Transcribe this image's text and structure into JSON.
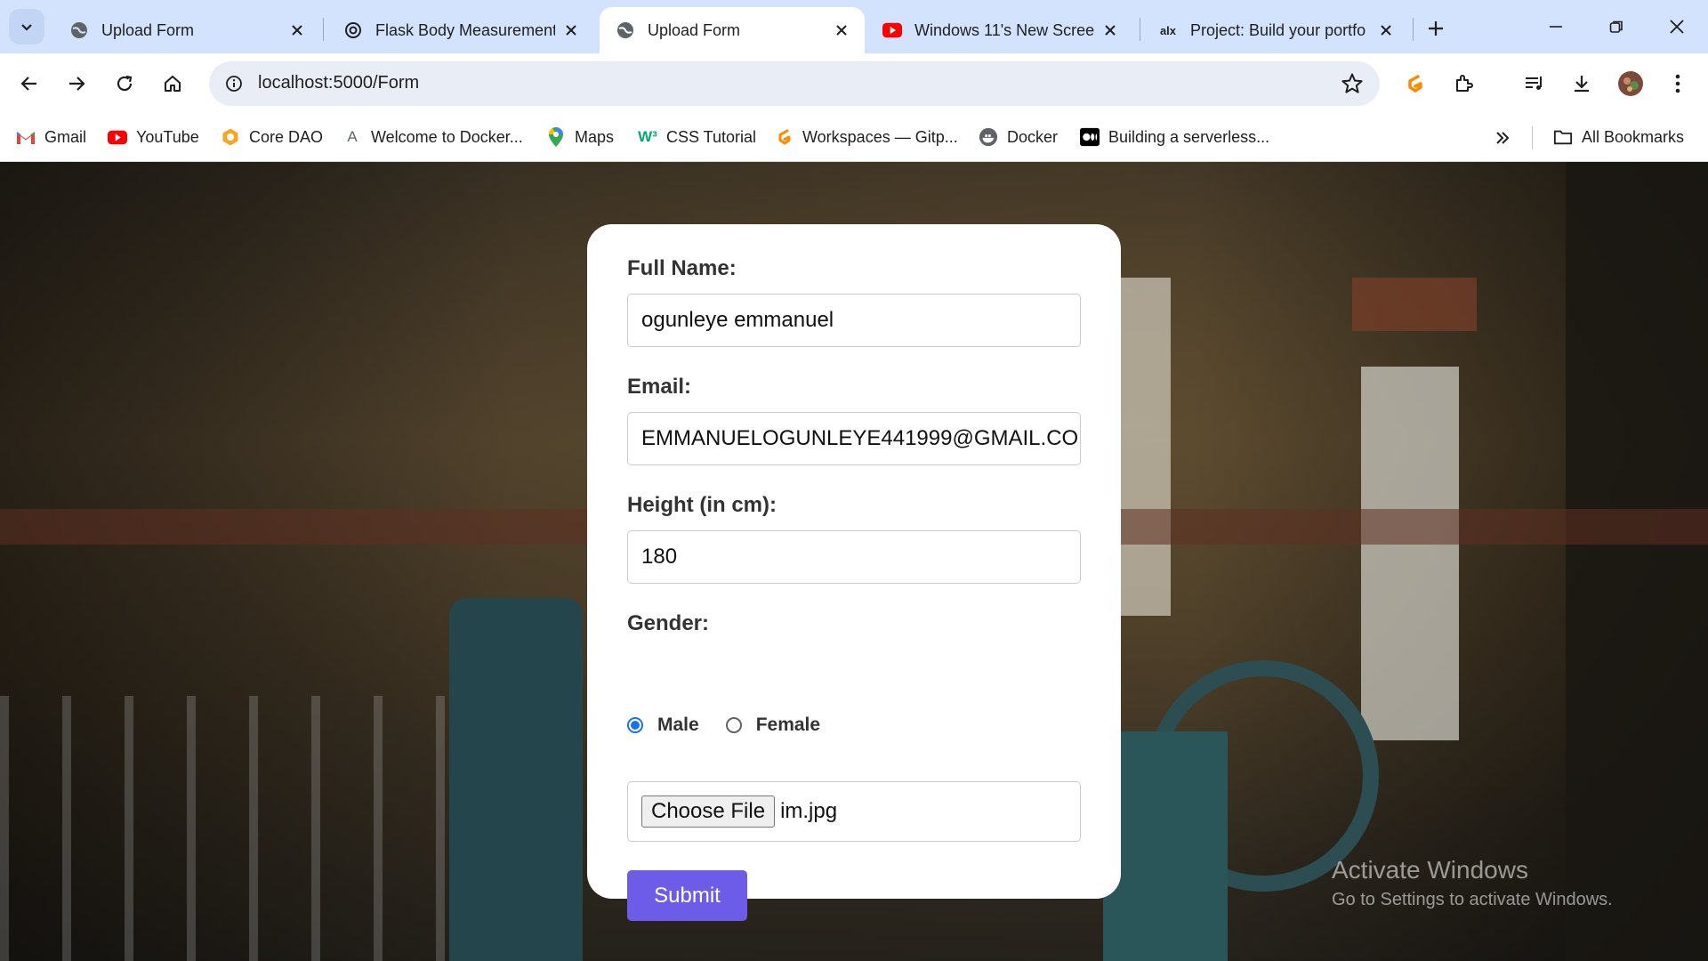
{
  "browser": {
    "tabs": [
      {
        "title": "Upload Form",
        "icon": "globe-icon",
        "active": false
      },
      {
        "title": "Flask Body Measurement",
        "icon": "chatgpt-icon",
        "active": false
      },
      {
        "title": "Upload Form",
        "icon": "globe-icon",
        "active": true
      },
      {
        "title": "Windows 11's New Scree",
        "icon": "youtube-icon",
        "active": false
      },
      {
        "title": "Project: Build your portfo",
        "icon": "alx-icon",
        "active": false
      }
    ],
    "url": "localhost:5000/Form",
    "bookmarks": [
      {
        "label": "Gmail",
        "icon": "gmail-icon"
      },
      {
        "label": "YouTube",
        "icon": "youtube-icon"
      },
      {
        "label": "Core DAO",
        "icon": "coredao-icon"
      },
      {
        "label": "Welcome to Docker...",
        "icon": "letter-a-icon"
      },
      {
        "label": "Maps",
        "icon": "maps-icon"
      },
      {
        "label": "CSS Tutorial",
        "icon": "w3schools-icon"
      },
      {
        "label": "Workspaces — Gitp...",
        "icon": "gitpod-icon"
      },
      {
        "label": "Docker",
        "icon": "docker-icon"
      },
      {
        "label": "Building a serverless...",
        "icon": "medium-icon"
      }
    ],
    "all_bookmarks_label": "All Bookmarks",
    "colors": {
      "tabstrip": "#d3e3fd",
      "omnibox": "#e9eef6"
    }
  },
  "form": {
    "full_name_label": "Full Name:",
    "full_name_value": "ogunleye emmanuel",
    "email_label": "Email:",
    "email_value": "EMMANUELOGUNLEYE441999@GMAIL.CO",
    "height_label": "Height (in cm):",
    "height_value": "180",
    "gender_label": "Gender:",
    "gender_options": [
      {
        "label": "Male",
        "checked": true
      },
      {
        "label": "Female",
        "checked": false
      }
    ],
    "file_button_label": "Choose File",
    "file_name": "im.jpg",
    "submit_label": "Submit",
    "colors": {
      "submit": "#6c5ce7",
      "radio": "#1a73e8"
    }
  },
  "watermark": {
    "line1": "Activate Windows",
    "line2": "Go to Settings to activate Windows."
  }
}
